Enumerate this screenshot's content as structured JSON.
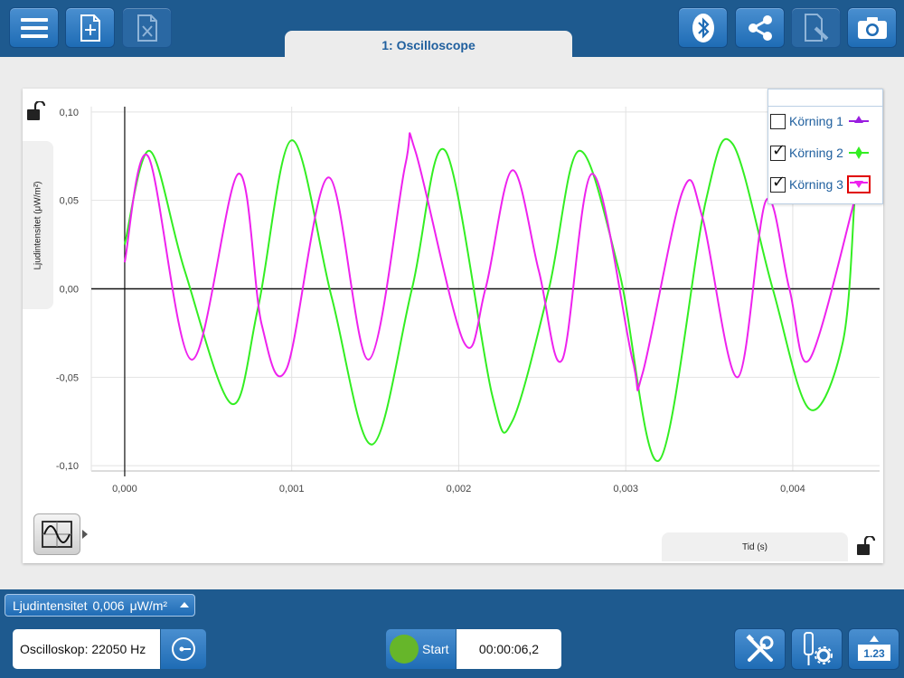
{
  "tab": {
    "label": "1: Oscilloscope"
  },
  "topbar": {
    "buttons": [
      {
        "icon": "menu-icon"
      },
      {
        "icon": "new-file-icon"
      },
      {
        "icon": "close-file-icon"
      },
      {
        "icon": "bluetooth-icon"
      },
      {
        "icon": "share-icon"
      },
      {
        "icon": "edit-document-icon"
      },
      {
        "icon": "camera-icon"
      }
    ]
  },
  "graph": {
    "y_axis_label": "Ljudintensitet (μW/m²)",
    "x_axis_label": "Tid (s)"
  },
  "legend": {
    "items": [
      {
        "label": "Körning 1",
        "checked": false,
        "color": "#9a1ee0",
        "marker": "up-triangle",
        "selected": false
      },
      {
        "label": "Körning 2",
        "checked": true,
        "color": "#33ee22",
        "marker": "diamond",
        "selected": false
      },
      {
        "label": "Körning 3",
        "checked": true,
        "color": "#ee22ee",
        "marker": "down-triangle",
        "selected": true
      }
    ]
  },
  "chart_data": {
    "type": "line",
    "xlim": [
      -0.0002,
      0.00452
    ],
    "ylim": [
      -0.103,
      0.103
    ],
    "x_ticks": [
      0,
      0.001,
      0.002,
      0.003,
      0.004
    ],
    "x_tick_labels": [
      "0,000",
      "0,001",
      "0,002",
      "0,003",
      "0,004"
    ],
    "y_ticks": [
      0.1,
      0.05,
      0.0,
      -0.05,
      -0.1
    ],
    "y_tick_labels": [
      "0,10",
      "0,05",
      "0,00",
      "-0,05",
      "-0,10"
    ],
    "grid": true,
    "legend_position": "top-right",
    "series": [
      {
        "name": "Körning 2",
        "color": "#33ee22",
        "x": [
          0,
          0.00015,
          0.00036,
          0.00064,
          0.0008,
          0.001,
          0.00124,
          0.00148,
          0.00172,
          0.00192,
          0.0022,
          0.00232,
          0.00254,
          0.00272,
          0.00296,
          0.0032,
          0.00348,
          0.00364,
          0.00388,
          0.0041,
          0.0043,
          0.00437
        ],
        "y": [
          0.025,
          0.078,
          0.01,
          -0.065,
          -0.01,
          0.084,
          -0.005,
          -0.088,
          0.0,
          0.078,
          -0.06,
          -0.075,
          0.0,
          0.078,
          0.01,
          -0.097,
          0.05,
          0.082,
          0.0,
          -0.068,
          -0.03,
          0.05
        ]
      },
      {
        "name": "Körning 3",
        "color": "#ee22ee",
        "x": [
          0,
          0.00014,
          0.0004,
          0.00068,
          0.00082,
          0.00097,
          0.00122,
          0.00146,
          0.00168,
          0.00174,
          0.00203,
          0.00216,
          0.00232,
          0.00248,
          0.00262,
          0.0028,
          0.00304,
          0.0031,
          0.00334,
          0.00346,
          0.00367,
          0.00384,
          0.00398,
          0.0041,
          0.00437
        ],
        "y": [
          0.015,
          0.075,
          -0.04,
          0.065,
          -0.02,
          -0.045,
          0.063,
          -0.04,
          0.07,
          0.078,
          -0.03,
          0.0,
          0.067,
          0.01,
          -0.04,
          0.065,
          -0.04,
          -0.048,
          0.055,
          0.04,
          -0.05,
          0.05,
          0.0,
          -0.04,
          0.05
        ]
      }
    ]
  },
  "sensor_bar": {
    "sensor_name": "Ljudintensitet",
    "value": "0,006",
    "unit": "μW/m²"
  },
  "bottombar": {
    "sample_rate": "Oscilloskop: 22050 Hz",
    "start_label": "Start",
    "elapsed_time": "00:00:06,2",
    "buttons": [
      {
        "icon": "tools-icon"
      },
      {
        "icon": "sensor-settings-icon"
      },
      {
        "icon": "digital-display-icon",
        "text": "1.23"
      }
    ]
  }
}
